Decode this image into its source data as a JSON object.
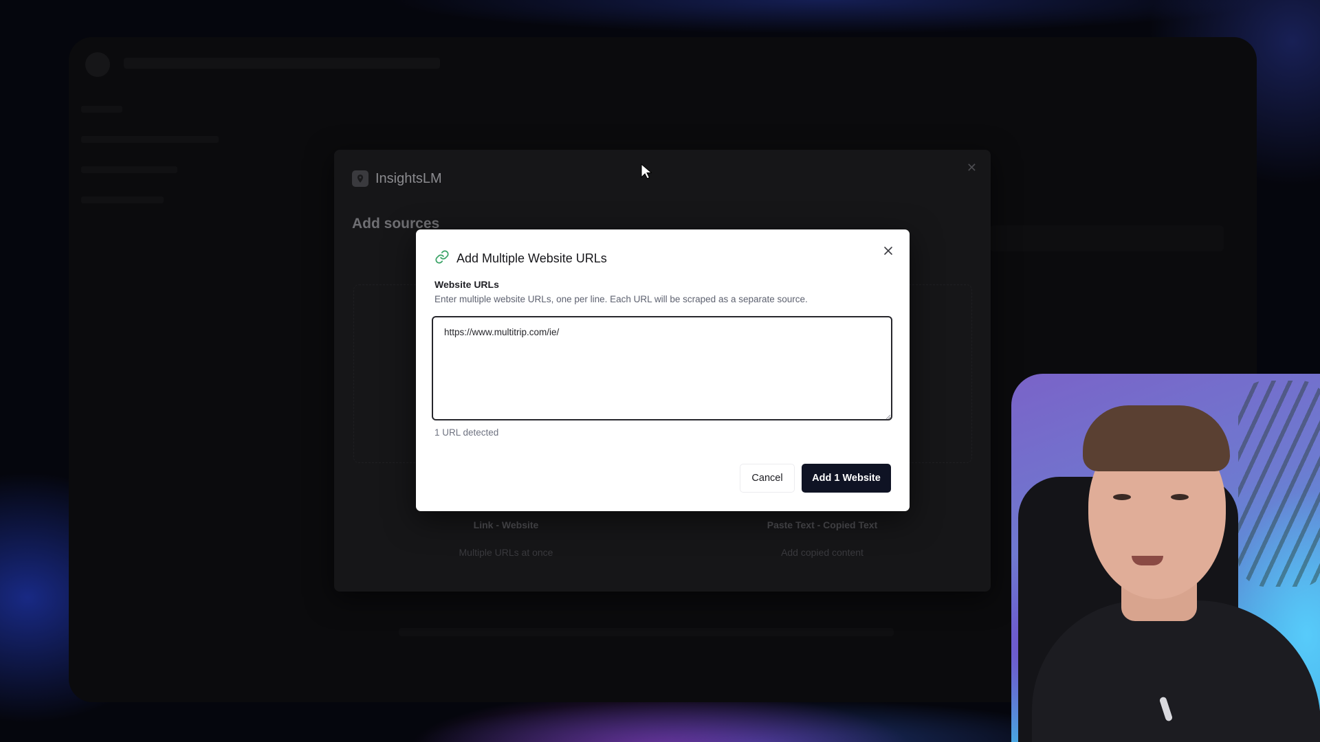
{
  "background_dialog": {
    "brand_name": "InsightsLM",
    "heading": "Add sources",
    "options": [
      {
        "title": "Link - Website",
        "description": "Multiple URLs at once"
      },
      {
        "title": "Paste Text - Copied Text",
        "description": "Add copied content"
      }
    ]
  },
  "modal": {
    "title": "Add Multiple Website URLs",
    "field_label": "Website URLs",
    "field_help": "Enter multiple website URLs, one per line. Each URL will be scraped as a separate source.",
    "textarea_value": "https://www.multitrip.com/ie/",
    "url_count": "1 URL detected",
    "cancel_label": "Cancel",
    "submit_label": "Add 1 Website"
  },
  "colors": {
    "primary_button": "#0f1324",
    "link_icon": "#3fa56a"
  },
  "icons": {
    "modal_title_icon": "link-icon",
    "close": "close-icon",
    "brand": "location-pin-icon"
  }
}
